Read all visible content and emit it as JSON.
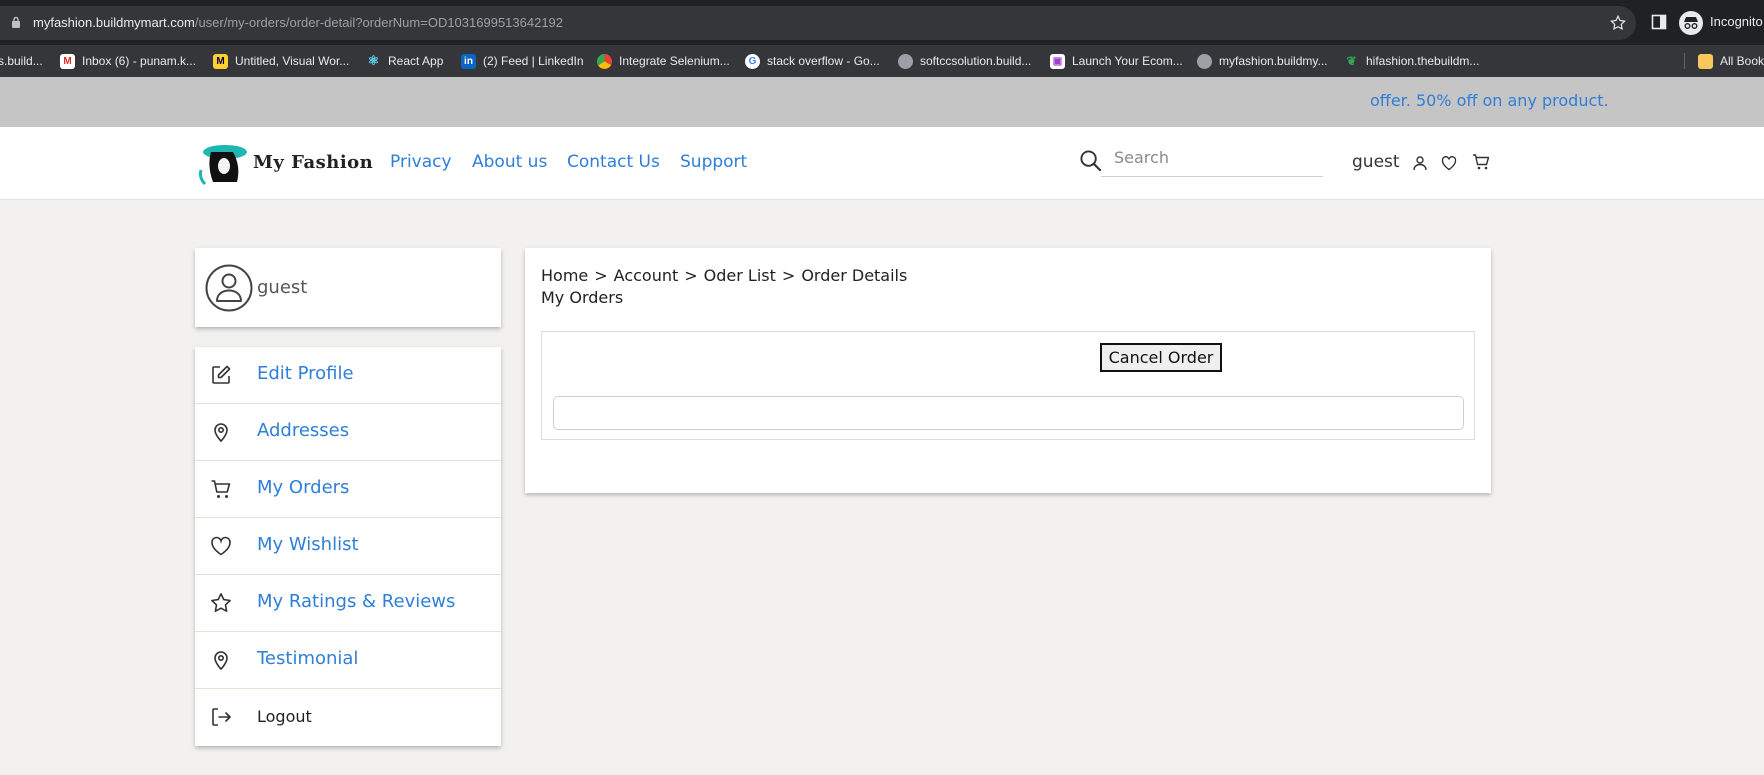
{
  "browser": {
    "url_host": "myfashion.buildmymart.com",
    "url_path": "/user/my-orders/order-detail?orderNum=OD1031699513642192",
    "incognito_label": "Incognito",
    "bookmarks": [
      {
        "label": "s.build...",
        "icon": "page-icon"
      },
      {
        "label": "Inbox (6) - punam.k...",
        "icon": "gmail-icon"
      },
      {
        "label": "Untitled, Visual Wor...",
        "icon": "miro-icon"
      },
      {
        "label": "React App",
        "icon": "react-icon"
      },
      {
        "label": "(2) Feed | LinkedIn",
        "icon": "linkedin-icon"
      },
      {
        "label": "Integrate Selenium...",
        "icon": "chrome-icon"
      },
      {
        "label": "stack overflow - Go...",
        "icon": "google-icon"
      },
      {
        "label": "softccsolution.build...",
        "icon": "globe-icon"
      },
      {
        "label": "Launch Your Ecom...",
        "icon": "store-icon"
      },
      {
        "label": "myfashion.buildmy...",
        "icon": "globe-icon"
      },
      {
        "label": "hifashion.thebuildm...",
        "icon": "leaf-icon"
      },
      {
        "label": "All Book",
        "icon": "folder-icon"
      }
    ]
  },
  "promo": {
    "text": "offer. 50% off on any product."
  },
  "header": {
    "logo_text": "My Fashion",
    "nav": [
      "Privacy",
      "About us",
      "Contact Us",
      "Support"
    ],
    "search_placeholder": "Search",
    "user_label": "guest",
    "accent": "#2f7fd8"
  },
  "sidebar": {
    "profile_name": "guest",
    "menu": [
      {
        "label": "Edit Profile",
        "icon": "edit-icon"
      },
      {
        "label": "Addresses",
        "icon": "location-pin-icon"
      },
      {
        "label": "My Orders",
        "icon": "cart-icon"
      },
      {
        "label": "My Wishlist",
        "icon": "heart-icon"
      },
      {
        "label": "My Ratings & Reviews",
        "icon": "star-icon"
      },
      {
        "label": "Testimonial",
        "icon": "location-pin-icon"
      },
      {
        "label": "Logout",
        "icon": "logout-icon"
      }
    ]
  },
  "order": {
    "breadcrumb": [
      "Home",
      "Account",
      "Oder List",
      "Order Details"
    ],
    "breadcrumb_separator": ">",
    "title": "My Orders",
    "cancel_label": "Cancel Order"
  }
}
